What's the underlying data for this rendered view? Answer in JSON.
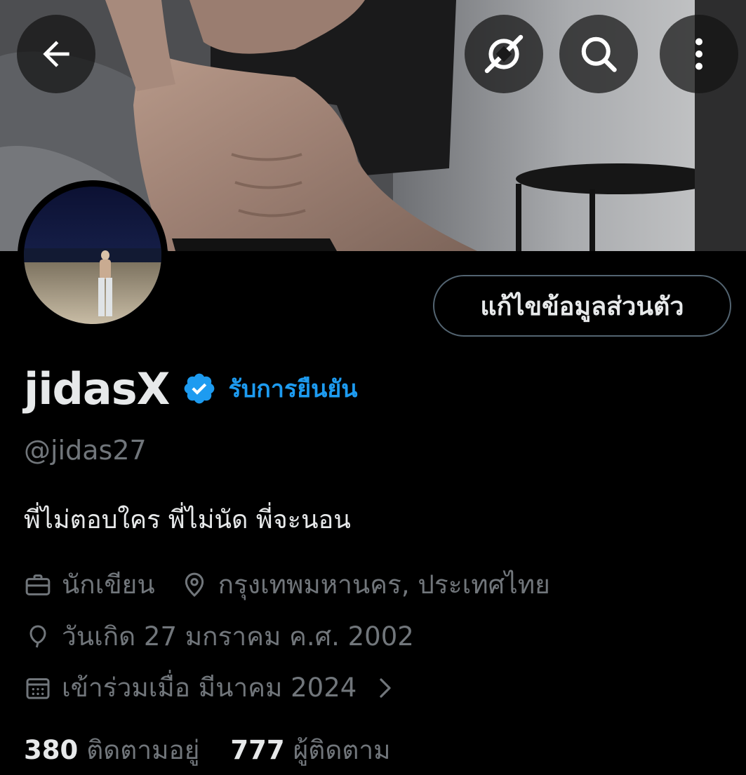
{
  "header": {
    "back_icon": "arrow-left-icon",
    "grok_icon": "grok-icon",
    "search_icon": "search-icon",
    "more_icon": "more-vertical-icon"
  },
  "profile": {
    "display_name": "jidasX",
    "verified_icon": "verified-badge-icon",
    "get_verified_label": "รับการยืนยัน",
    "handle": "@jidas27",
    "bio": "พี่ไม่ตอบใคร พี่ไม่นัด พี่จะนอน",
    "edit_profile_label": "แก้ไขข้อมูลส่วนตัว",
    "profession": "นักเขียน",
    "location": "กรุงเทพมหานคร, ประเทศไทย",
    "birthday": "วันเกิด 27 มกราคม ค.ศ. 2002",
    "joined": "เข้าร่วมเมื่อ มีนาคม 2024",
    "following_count": "380",
    "following_label": "ติดตามอยู่",
    "followers_count": "777",
    "followers_label": "ผู้ติดตาม"
  },
  "colors": {
    "background": "#000000",
    "text_primary": "#e7e9ea",
    "text_secondary": "#71767b",
    "accent": "#1d9bf0",
    "border": "#536471"
  }
}
